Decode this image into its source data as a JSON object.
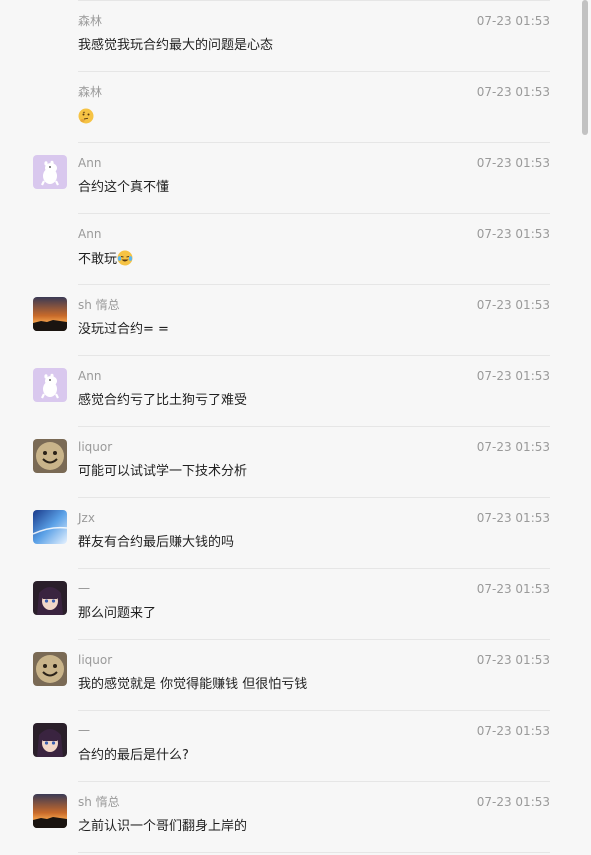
{
  "messages": [
    {
      "name": "森林",
      "time": "07-23 01:53",
      "text": "我感觉我玩合约最大的问题是心态",
      "avatar": "none"
    },
    {
      "name": "森林",
      "time": "07-23 01:53",
      "text": "",
      "emoji": "thinking-face-emoji",
      "avatar": "none"
    },
    {
      "name": "Ann",
      "time": "07-23 01:53",
      "text": "合约这个真不懂",
      "avatar": "moomin-avatar"
    },
    {
      "name": "Ann",
      "time": "07-23 01:53",
      "text": "不敢玩",
      "emoji": "laughing-tears-emoji",
      "avatar": "none"
    },
    {
      "name": "sh 惰总",
      "time": "07-23 01:53",
      "text": "没玩过合约= =",
      "avatar": "sunset-avatar"
    },
    {
      "name": "Ann",
      "time": "07-23 01:53",
      "text": "感觉合约亏了比土狗亏了难受",
      "avatar": "moomin-avatar"
    },
    {
      "name": "liquor",
      "time": "07-23 01:53",
      "text": "可能可以试试学一下技术分析",
      "avatar": "smiley-avatar"
    },
    {
      "name": "Jzx",
      "time": "07-23 01:53",
      "text": "群友有合约最后赚大钱的吗",
      "avatar": "sky-avatar"
    },
    {
      "name": "一",
      "time": "07-23 01:53",
      "text": "那么问题来了",
      "avatar": "anime-avatar"
    },
    {
      "name": "liquor",
      "time": "07-23 01:53",
      "text": "我的感觉就是 你觉得能赚钱 但很怕亏钱",
      "avatar": "smiley-avatar"
    },
    {
      "name": "一",
      "time": "07-23 01:53",
      "text": "合约的最后是什么?",
      "avatar": "anime-avatar"
    },
    {
      "name": "sh 惰总",
      "time": "07-23 01:53",
      "text": "之前认识一个哥们翻身上岸的",
      "avatar": "sunset-avatar"
    }
  ]
}
